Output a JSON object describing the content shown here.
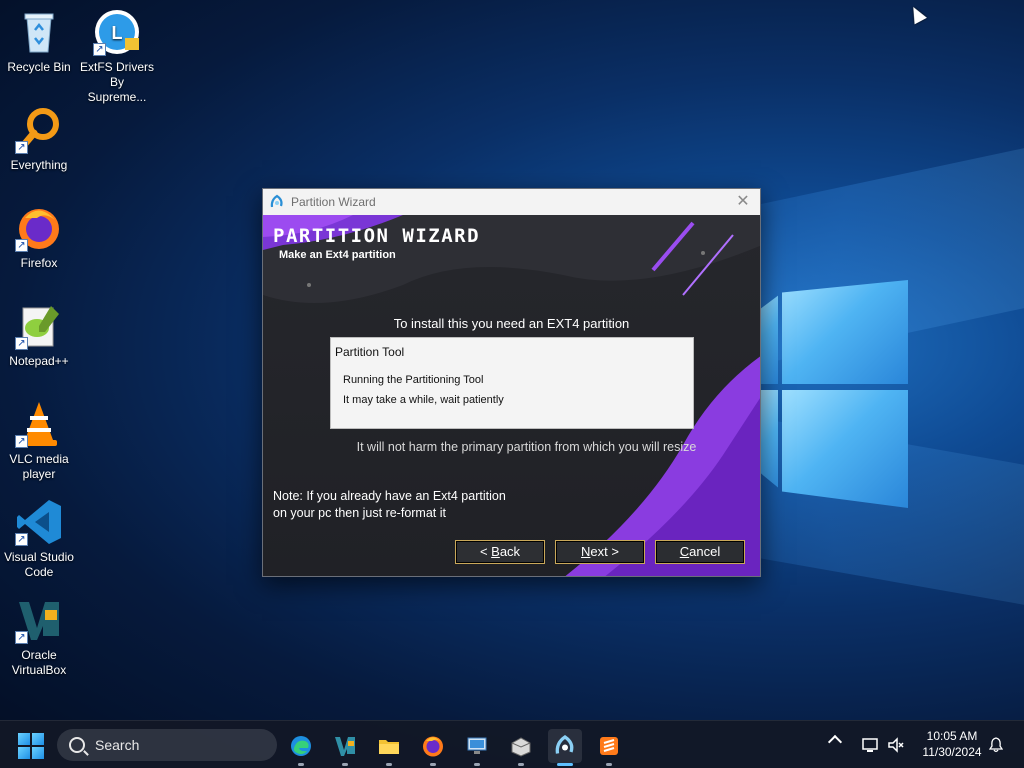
{
  "desktop": {
    "icons": [
      {
        "label": "Recycle Bin",
        "icon": "recycle-bin-icon"
      },
      {
        "label": "ExtFS Drivers By Supreme...",
        "icon": "extfs-drivers-icon"
      },
      {
        "label": "Everything",
        "icon": "everything-search-icon"
      },
      {
        "label": "Firefox",
        "icon": "firefox-icon"
      },
      {
        "label": "Notepad++",
        "icon": "notepadpp-icon"
      },
      {
        "label": "VLC media player",
        "icon": "vlc-icon"
      },
      {
        "label": "Visual Studio Code",
        "icon": "vscode-icon"
      },
      {
        "label": "Oracle VirtualBox",
        "icon": "virtualbox-icon"
      }
    ]
  },
  "dialog": {
    "title": "Partition Wizard",
    "close_label": "✕",
    "banner_title": "PARTITION WIZARD",
    "banner_subtitle": "Make an Ext4 partition",
    "info_text": "To install this you need an EXT4 partition",
    "panel": {
      "title": "Partition Tool",
      "line1": "Running the Partitioning Tool",
      "line2": "It may take a while, wait patiently"
    },
    "harm_text": "It will not harm the primary partition from which you will resize",
    "note_line1": "Note: If you already have an Ext4 partition",
    "note_line2": "on your pc then just re-format it",
    "buttons": {
      "back_prefix": "< ",
      "back_mnemonic": "B",
      "back_rest": "ack",
      "next_mnemonic": "N",
      "next_rest": "ext >",
      "cancel_mnemonic": "C",
      "cancel_rest": "ancel"
    }
  },
  "taskbar": {
    "search_placeholder": "Search",
    "apps": [
      "edge-icon",
      "virtualbox-icon",
      "file-explorer-icon",
      "firefox-icon",
      "remote-desktop-icon",
      "package-icon",
      "partition-wizard-icon",
      "sublime-text-icon"
    ],
    "time": "10:05 AM",
    "date": "11/30/2024"
  },
  "colors": {
    "accent_purple": "#8a3ce0",
    "button_border": "#c9a85a",
    "taskbar_active": "#5fc0ff"
  }
}
